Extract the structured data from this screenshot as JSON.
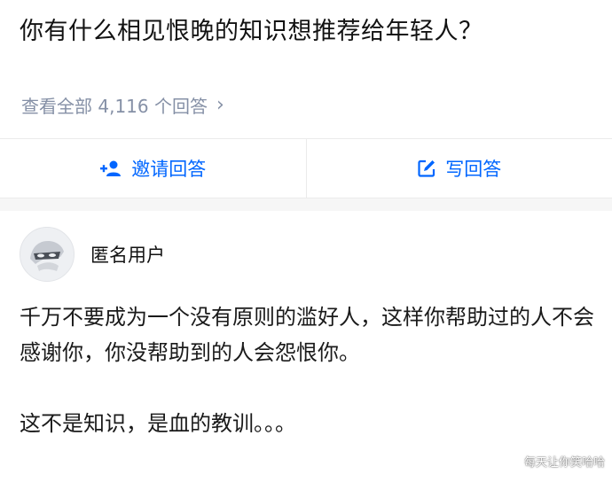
{
  "question": {
    "title": "你有什么相见恨晚的知识想推荐给年轻人？",
    "view_all": "查看全部 4,116 个回答"
  },
  "actions": {
    "invite_label": "邀请回答",
    "write_label": "写回答",
    "invite_icon": "add-user-icon",
    "write_icon": "edit-icon"
  },
  "answer": {
    "author": "匿名用户",
    "paragraphs": [
      "千万不要成为一个没有原则的滥好人，这样你帮助过的人不会感谢你，你没帮助到的人会怨恨你。",
      "这不是知识，是血的教训。。。"
    ]
  },
  "watermark": "每天让你笑哈哈",
  "colors": {
    "accent": "#0066ff",
    "muted": "#8590a6",
    "divider": "#ebebeb",
    "gap": "#f6f6f6"
  }
}
